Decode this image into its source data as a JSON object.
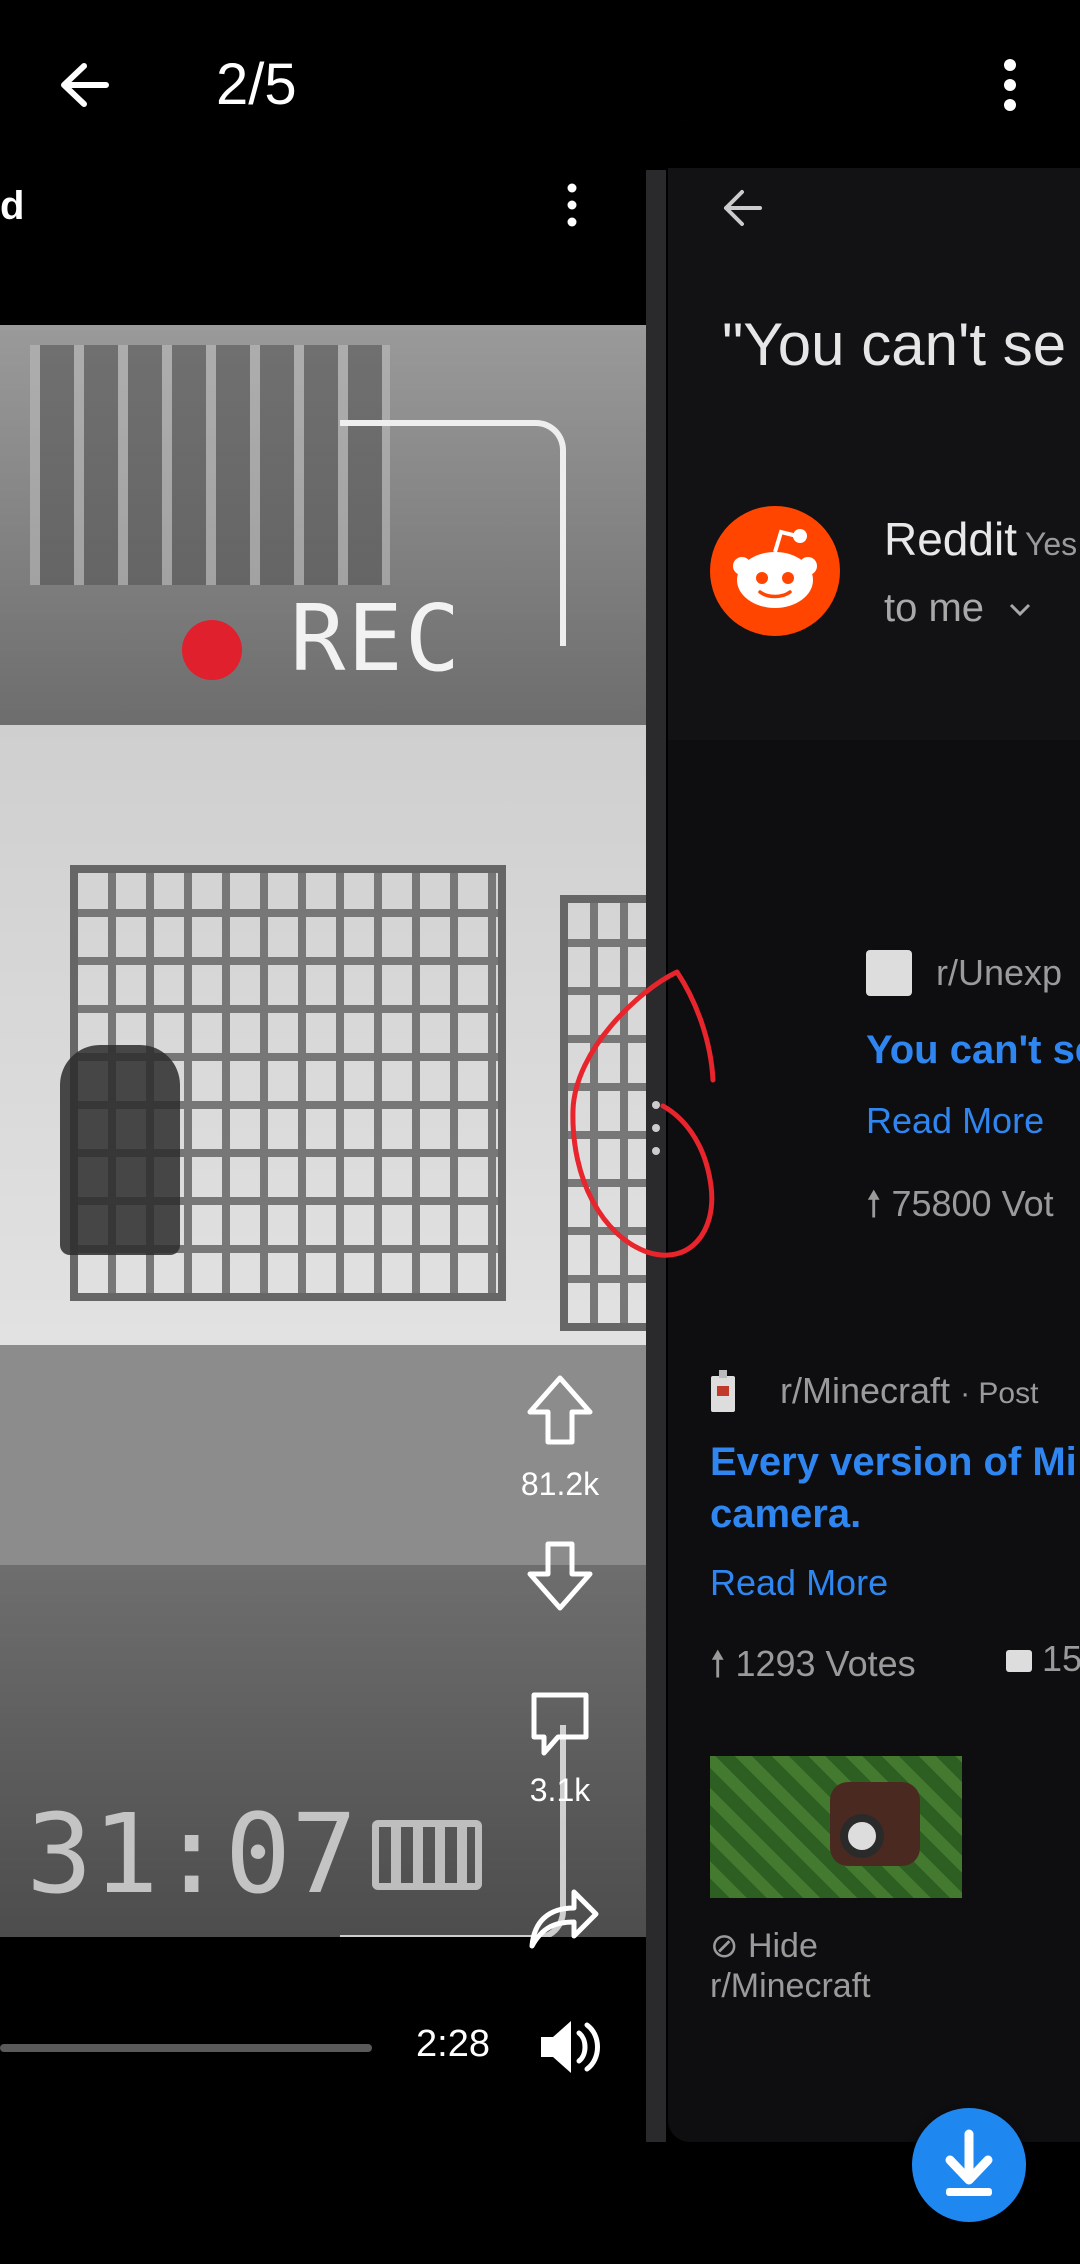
{
  "viewer": {
    "counter": "2/5"
  },
  "video": {
    "title_fragment": "d",
    "overlay_rec": "REC",
    "overlay_time": ":31:07",
    "upvotes": "81.2k",
    "comments": "3.1k",
    "duration": "2:28"
  },
  "email": {
    "subject": "\"You can't se",
    "sender": "Reddit",
    "sender_suffix": "Yes",
    "recipient": "to me",
    "posts": [
      {
        "subreddit": "r/Unexp",
        "title": "You can't se",
        "read_more": "Read More",
        "votes": "75800 Vot"
      },
      {
        "subreddit": "r/Minecraft",
        "meta": "· Post",
        "title_line1": "Every version of Mi",
        "title_line2": "camera.",
        "read_more": "Read More",
        "votes": "1293 Votes",
        "comments": "15",
        "hide": "Hide",
        "hide_sub": "r/Minecraft"
      }
    ]
  },
  "colors": {
    "link": "#2f86f0",
    "reddit": "#ff4500",
    "fab": "#1e88f0",
    "annotation": "#e8242c"
  },
  "icons": [
    "back-arrow-icon",
    "more-vert-icon",
    "upvote-icon",
    "downvote-icon",
    "comment-icon",
    "share-icon",
    "volume-icon",
    "download-icon"
  ]
}
